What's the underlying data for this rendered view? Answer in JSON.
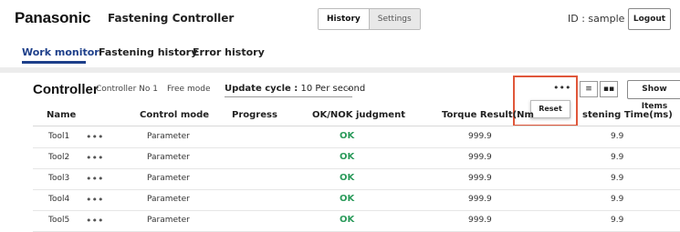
{
  "header": {
    "brand": "Panasonic",
    "app_title": "Fastening Controller",
    "history_label": "History",
    "settings_label": "Settings",
    "user_id": "ID : sample",
    "logout_label": "Logout"
  },
  "tabs": [
    {
      "label": "Work monitor",
      "active": true
    },
    {
      "label": "Fastening history",
      "active": false
    },
    {
      "label": "Error history",
      "active": false
    }
  ],
  "controller": {
    "title": "Controller",
    "name": "Controller No 1",
    "mode": "Free mode",
    "update_label": "Update cycle :",
    "update_value": "10 Per second",
    "more_label": "•••",
    "reset_label": "Reset",
    "show_items_label": "Show Items",
    "list_view_icon": "≡",
    "grid_view_icon": "▪▪"
  },
  "table": {
    "headers": [
      "Name",
      "Control mode",
      "Progress",
      "OK/NOK judgment",
      "Torque Result(Nm",
      "stening Time(ms)"
    ],
    "rows": [
      {
        "name": "Tool1",
        "menu": "•••",
        "mode": "Parameter",
        "judgment": "OK",
        "torque": "999.9",
        "time": "9.9"
      },
      {
        "name": "Tool2",
        "menu": "•••",
        "mode": "Parameter",
        "judgment": "OK",
        "torque": "999.9",
        "time": "9.9"
      },
      {
        "name": "Tool3",
        "menu": "•••",
        "mode": "Parameter",
        "judgment": "OK",
        "torque": "999.9",
        "time": "9.9"
      },
      {
        "name": "Tool4",
        "menu": "•••",
        "mode": "Parameter",
        "judgment": "OK",
        "torque": "999.9",
        "time": "9.9"
      },
      {
        "name": "Tool5",
        "menu": "•••",
        "mode": "Parameter",
        "judgment": "OK",
        "torque": "999.9",
        "time": "9.9"
      }
    ]
  },
  "colors": {
    "accent": "#1d3f8a",
    "ok": "#2a9a5a",
    "highlight": "#e0573a"
  }
}
